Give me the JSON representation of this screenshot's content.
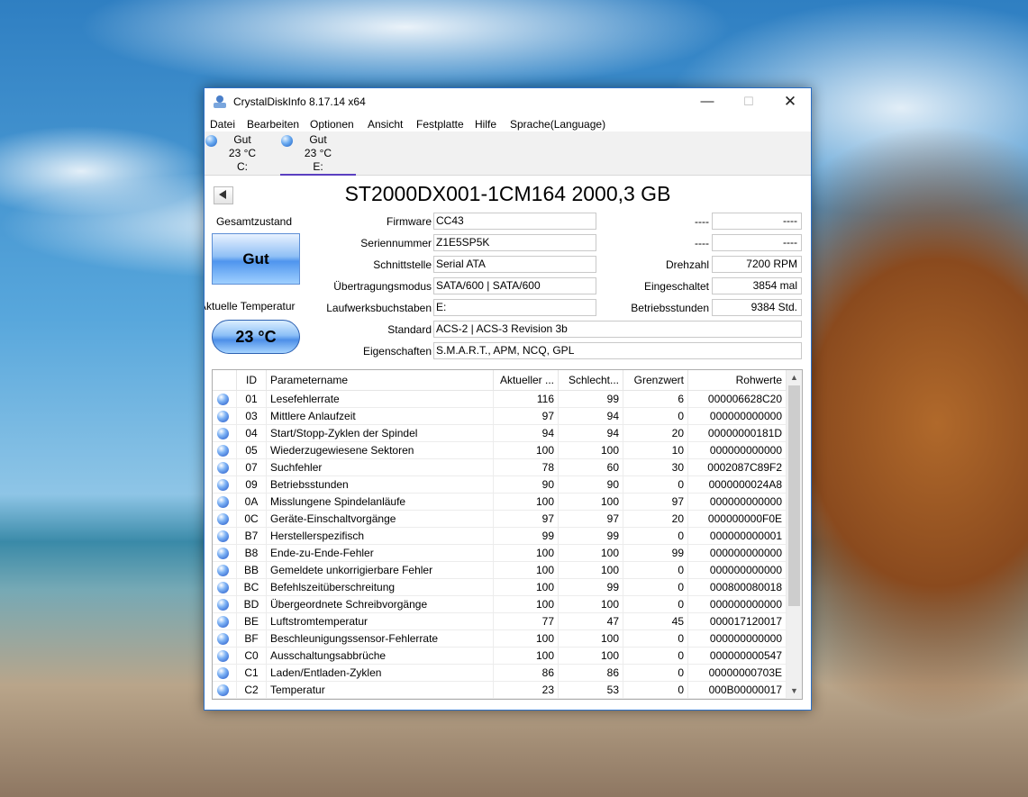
{
  "window": {
    "title": "CrystalDiskInfo 8.17.14 x64",
    "controls": {
      "minimize": "—",
      "maximize": "☐",
      "close": "✕"
    }
  },
  "menu": [
    "Datei",
    "Bearbeiten",
    "Optionen",
    "Ansicht",
    "Festplatte",
    "Hilfe",
    "Sprache(Language)"
  ],
  "disk_tabs": [
    {
      "status": "Gut",
      "temp": "23 °C",
      "drive": "C:"
    },
    {
      "status": "Gut",
      "temp": "23 °C",
      "drive": "E:"
    }
  ],
  "disk_title": "ST2000DX001-1CM164 2000,3 GB",
  "health": {
    "label": "Gesamtzustand",
    "status": "Gut"
  },
  "temperature": {
    "label": "Aktuelle Temperatur",
    "value": "23 °C"
  },
  "info": {
    "firmware": {
      "label": "Firmware",
      "value": "CC43"
    },
    "serial": {
      "label": "Seriennummer",
      "value": "Z1E5SP5K"
    },
    "interface": {
      "label": "Schnittstelle",
      "value": "Serial ATA"
    },
    "transfer": {
      "label": "Übertragungsmodus",
      "value": "SATA/600 | SATA/600"
    },
    "drive_letters": {
      "label": "Laufwerksbuchstaben",
      "value": "E:"
    },
    "standard": {
      "label": "Standard",
      "value": "ACS-2 | ACS-3 Revision 3b"
    },
    "features": {
      "label": "Eigenschaften",
      "value": "S.M.A.R.T., APM, NCQ, GPL"
    }
  },
  "right_info": {
    "r1": {
      "label": "----",
      "value": "----"
    },
    "r2": {
      "label": "----",
      "value": "----"
    },
    "rpm": {
      "label": "Drehzahl",
      "value": "7200 RPM"
    },
    "power_on_count": {
      "label": "Eingeschaltet",
      "value": "3854 mal"
    },
    "power_on_hours": {
      "label": "Betriebsstunden",
      "value": "9384 Std."
    }
  },
  "smart": {
    "headers": {
      "id": "ID",
      "name": "Parametername",
      "current": "Aktueller ...",
      "worst": "Schlecht...",
      "threshold": "Grenzwert",
      "raw": "Rohwerte"
    },
    "rows": [
      {
        "id": "01",
        "name": "Lesefehlerrate",
        "current": "116",
        "worst": "99",
        "threshold": "6",
        "raw": "000006628C20"
      },
      {
        "id": "03",
        "name": "Mittlere Anlaufzeit",
        "current": "97",
        "worst": "94",
        "threshold": "0",
        "raw": "000000000000"
      },
      {
        "id": "04",
        "name": "Start/Stopp-Zyklen der Spindel",
        "current": "94",
        "worst": "94",
        "threshold": "20",
        "raw": "00000000181D"
      },
      {
        "id": "05",
        "name": "Wiederzugewiesene Sektoren",
        "current": "100",
        "worst": "100",
        "threshold": "10",
        "raw": "000000000000"
      },
      {
        "id": "07",
        "name": "Suchfehler",
        "current": "78",
        "worst": "60",
        "threshold": "30",
        "raw": "0002087C89F2"
      },
      {
        "id": "09",
        "name": "Betriebsstunden",
        "current": "90",
        "worst": "90",
        "threshold": "0",
        "raw": "0000000024A8"
      },
      {
        "id": "0A",
        "name": "Misslungene Spindelanläufe",
        "current": "100",
        "worst": "100",
        "threshold": "97",
        "raw": "000000000000"
      },
      {
        "id": "0C",
        "name": "Geräte-Einschaltvorgänge",
        "current": "97",
        "worst": "97",
        "threshold": "20",
        "raw": "000000000F0E"
      },
      {
        "id": "B7",
        "name": "Herstellerspezifisch",
        "current": "99",
        "worst": "99",
        "threshold": "0",
        "raw": "000000000001"
      },
      {
        "id": "B8",
        "name": "Ende-zu-Ende-Fehler",
        "current": "100",
        "worst": "100",
        "threshold": "99",
        "raw": "000000000000"
      },
      {
        "id": "BB",
        "name": "Gemeldete unkorrigierbare Fehler",
        "current": "100",
        "worst": "100",
        "threshold": "0",
        "raw": "000000000000"
      },
      {
        "id": "BC",
        "name": "Befehlszeitüberschreitung",
        "current": "100",
        "worst": "99",
        "threshold": "0",
        "raw": "000800080018"
      },
      {
        "id": "BD",
        "name": "Übergeordnete Schreibvorgänge",
        "current": "100",
        "worst": "100",
        "threshold": "0",
        "raw": "000000000000"
      },
      {
        "id": "BE",
        "name": "Luftstromtemperatur",
        "current": "77",
        "worst": "47",
        "threshold": "45",
        "raw": "000017120017"
      },
      {
        "id": "BF",
        "name": "Beschleunigungssensor-Fehlerrate",
        "current": "100",
        "worst": "100",
        "threshold": "0",
        "raw": "000000000000"
      },
      {
        "id": "C0",
        "name": "Ausschaltungsabbrüche",
        "current": "100",
        "worst": "100",
        "threshold": "0",
        "raw": "000000000547"
      },
      {
        "id": "C1",
        "name": "Laden/Entladen-Zyklen",
        "current": "86",
        "worst": "86",
        "threshold": "0",
        "raw": "00000000703E"
      },
      {
        "id": "C2",
        "name": "Temperatur",
        "current": "23",
        "worst": "53",
        "threshold": "0",
        "raw": "000B00000017"
      }
    ]
  },
  "colors": {
    "accent": "#2b6fc6",
    "tab_underline": "#5a3fc0",
    "health_blue": "#4f95ee"
  }
}
